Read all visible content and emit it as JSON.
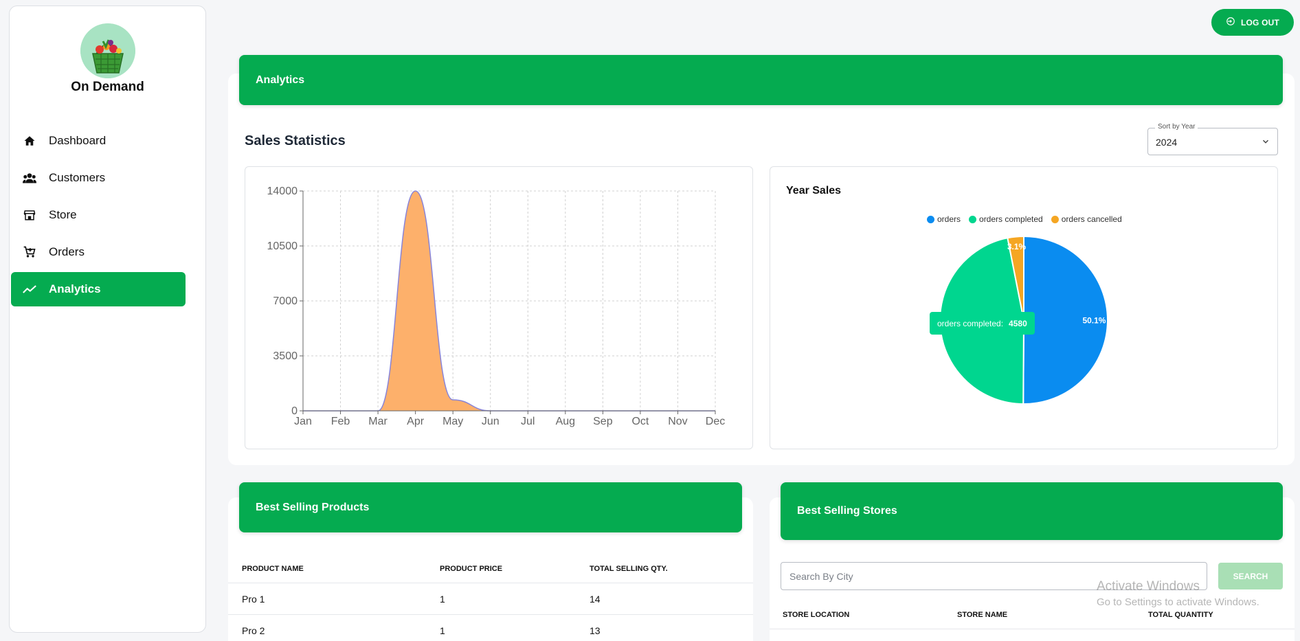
{
  "brand": {
    "name": "On Demand"
  },
  "colors": {
    "accent": "#05ab50",
    "orders": "#0a8cf0",
    "orders_completed": "#00d68f",
    "orders_cancelled": "#f5a623",
    "area_fill": "#fdb06b",
    "area_stroke": "#8884d8"
  },
  "sidebar": {
    "items": [
      {
        "label": "Dashboard",
        "icon": "home-icon"
      },
      {
        "label": "Customers",
        "icon": "users-icon"
      },
      {
        "label": "Store",
        "icon": "store-icon"
      },
      {
        "label": "Orders",
        "icon": "cart-icon"
      },
      {
        "label": "Analytics",
        "icon": "trend-icon",
        "active": true
      }
    ]
  },
  "header": {
    "logout_label": "LOG OUT"
  },
  "analytics": {
    "banner": "Analytics",
    "sales_title": "Sales Statistics",
    "sort": {
      "legend": "Sort by Year",
      "value": "2024"
    },
    "year_sales_title": "Year Sales",
    "tooltip": {
      "label": "orders completed:",
      "value": "4580"
    }
  },
  "chart_data": [
    {
      "type": "area",
      "x": [
        "Jan",
        "Feb",
        "Mar",
        "Apr",
        "May",
        "Jun",
        "Jul",
        "Aug",
        "Sep",
        "Oct",
        "Nov",
        "Dec"
      ],
      "y": [
        0,
        0,
        0,
        14000,
        700,
        0,
        0,
        0,
        0,
        0,
        0,
        0
      ],
      "yticks": [
        0,
        3500,
        7000,
        10500,
        14000
      ],
      "ylim": [
        0,
        14000
      ],
      "grid": true,
      "title": "",
      "xlabel": "",
      "ylabel": ""
    },
    {
      "type": "pie",
      "title": "Year Sales",
      "legend": "top",
      "slices": [
        {
          "name": "orders",
          "value": 50.1,
          "label": "50.1%"
        },
        {
          "name": "orders completed",
          "value": 46.8,
          "label": ""
        },
        {
          "name": "orders cancelled",
          "value": 3.1,
          "label": "3.1%"
        }
      ]
    }
  ],
  "best_products": {
    "title": "Best Selling Products",
    "columns": [
      "PRODUCT NAME",
      "PRODUCT PRICE",
      "TOTAL SELLING QTY."
    ],
    "rows": [
      [
        "Pro 1",
        "1",
        "14"
      ],
      [
        "Pro 2",
        "1",
        "13"
      ]
    ]
  },
  "best_stores": {
    "title": "Best Selling Stores",
    "search_placeholder": "Search By City",
    "search_label": "SEARCH",
    "columns": [
      "STORE LOCATION",
      "STORE NAME",
      "TOTAL QUANTITY"
    ]
  },
  "watermark": {
    "line1": "Activate Windows",
    "line2": "Go to Settings to activate Windows."
  }
}
